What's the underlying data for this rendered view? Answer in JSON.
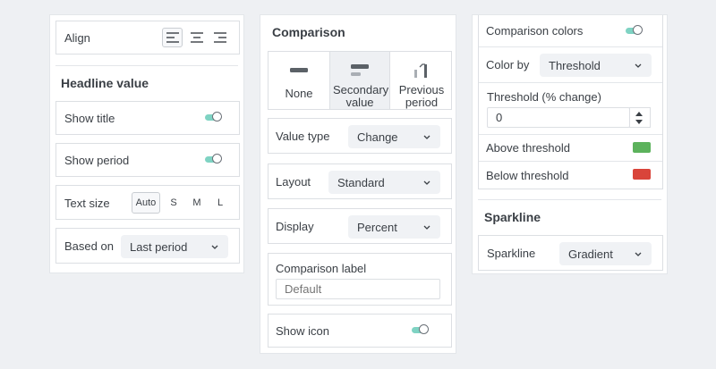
{
  "left": {
    "align_label": "Align",
    "headline_title": "Headline value",
    "show_title_label": "Show title",
    "show_period_label": "Show period",
    "text_size_label": "Text size",
    "text_sizes": [
      "Auto",
      "S",
      "M",
      "L"
    ],
    "text_size_selected": "Auto",
    "based_on_label": "Based on",
    "based_on_value": "Last period"
  },
  "middle": {
    "title": "Comparison",
    "options": [
      "None",
      "Secondary value",
      "Previous period"
    ],
    "selected_option": "Secondary value",
    "value_type_label": "Value type",
    "value_type_value": "Change",
    "layout_label": "Layout",
    "layout_value": "Standard",
    "display_label": "Display",
    "display_value": "Percent",
    "comparison_label_label": "Comparison label",
    "comparison_label_placeholder": "Default",
    "show_icon_label": "Show icon"
  },
  "right": {
    "comparison_colors_label": "Comparison colors",
    "color_by_label": "Color by",
    "color_by_value": "Threshold",
    "threshold_label": "Threshold (% change)",
    "threshold_value": "0",
    "above_threshold_label": "Above threshold",
    "below_threshold_label": "Below threshold",
    "above_color": "#5cb25c",
    "below_color": "#d9443a",
    "sparkline_title": "Sparkline",
    "sparkline_label": "Sparkline",
    "sparkline_value": "Gradient"
  },
  "icons": {
    "align": [
      "align-left-icon",
      "align-center-icon",
      "align-right-icon"
    ],
    "chevron": "chevron-down-icon"
  }
}
